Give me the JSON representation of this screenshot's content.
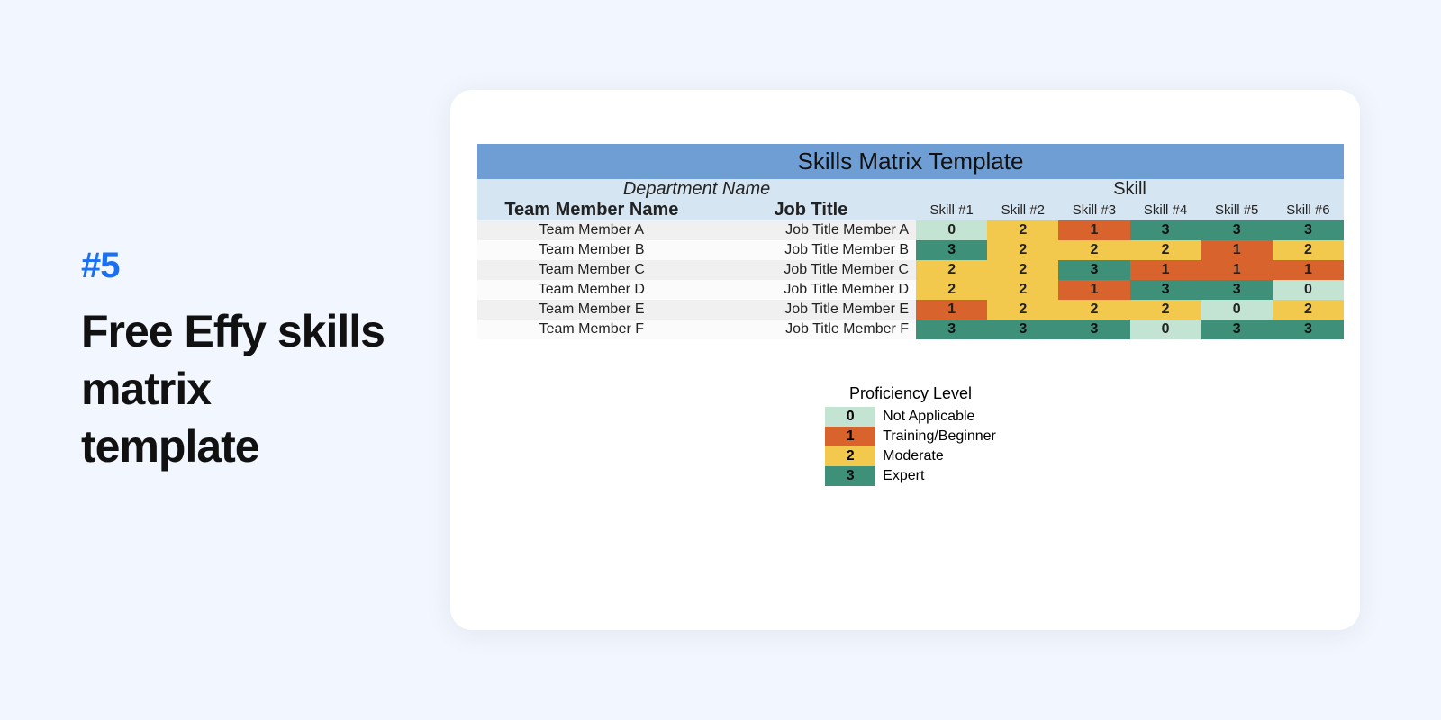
{
  "badge": "#5",
  "title": "Free Effy skills matrix template",
  "matrix": {
    "title": "Skills Matrix Template",
    "dept_label": "Department Name",
    "skill_group_label": "Skill",
    "name_header": "Team Member Name",
    "job_header": "Job Title",
    "skill_headers": [
      "Skill #1",
      "Skill #2",
      "Skill #3",
      "Skill #4",
      "Skill #5",
      "Skill #6"
    ],
    "rows": [
      {
        "name": "Team Member A",
        "job": "Job Title Member A",
        "levels": [
          0,
          2,
          1,
          3,
          3,
          3
        ]
      },
      {
        "name": "Team Member B",
        "job": "Job Title Member B",
        "levels": [
          3,
          2,
          2,
          2,
          1,
          2
        ]
      },
      {
        "name": "Team Member C",
        "job": "Job Title Member C",
        "levels": [
          2,
          2,
          3,
          1,
          1,
          1
        ]
      },
      {
        "name": "Team Member D",
        "job": "Job Title Member D",
        "levels": [
          2,
          2,
          1,
          3,
          3,
          0
        ]
      },
      {
        "name": "Team Member E",
        "job": "Job Title Member E",
        "levels": [
          1,
          2,
          2,
          2,
          0,
          2
        ]
      },
      {
        "name": "Team Member F",
        "job": "Job Title Member F",
        "levels": [
          3,
          3,
          3,
          0,
          3,
          3
        ]
      }
    ]
  },
  "legend": {
    "title": "Proficiency Level",
    "items": [
      {
        "value": 0,
        "label": "Not Applicable"
      },
      {
        "value": 1,
        "label": "Training/Beginner"
      },
      {
        "value": 2,
        "label": "Moderate"
      },
      {
        "value": 3,
        "label": "Expert"
      }
    ]
  },
  "chart_data": {
    "type": "heatmap",
    "title": "Skills Matrix Template",
    "row_labels": [
      "Team Member A",
      "Team Member B",
      "Team Member C",
      "Team Member D",
      "Team Member E",
      "Team Member F"
    ],
    "col_labels": [
      "Skill #1",
      "Skill #2",
      "Skill #3",
      "Skill #4",
      "Skill #5",
      "Skill #6"
    ],
    "values": [
      [
        0,
        2,
        1,
        3,
        3,
        3
      ],
      [
        3,
        2,
        2,
        2,
        1,
        2
      ],
      [
        2,
        2,
        3,
        1,
        1,
        1
      ],
      [
        2,
        2,
        1,
        3,
        3,
        0
      ],
      [
        1,
        2,
        2,
        2,
        0,
        2
      ],
      [
        3,
        3,
        3,
        0,
        3,
        3
      ]
    ],
    "scale": {
      "0": "Not Applicable",
      "1": "Training/Beginner",
      "2": "Moderate",
      "3": "Expert"
    }
  }
}
